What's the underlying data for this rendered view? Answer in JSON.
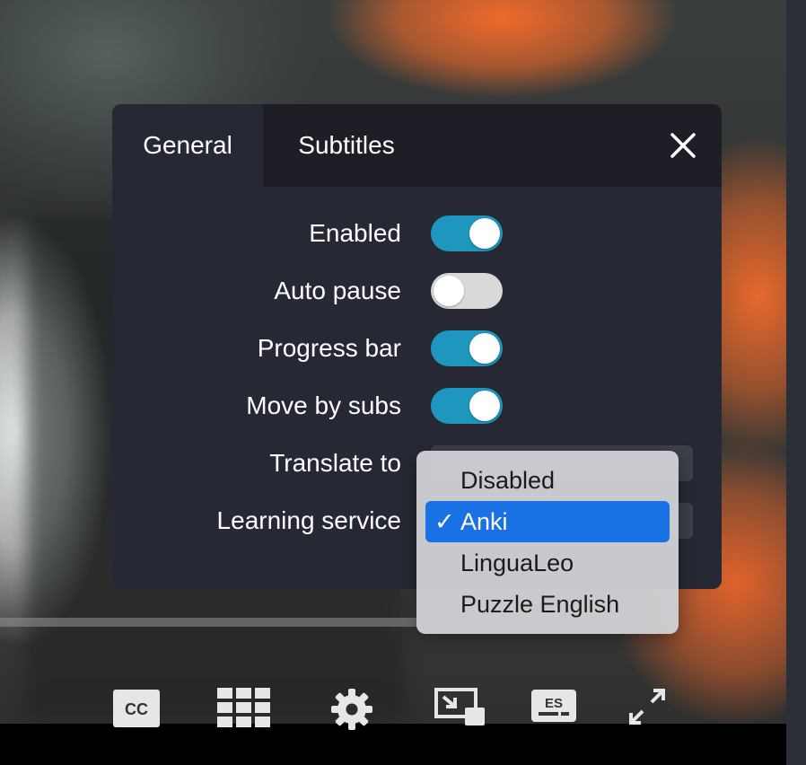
{
  "tabs": [
    {
      "label": "General",
      "active": true
    },
    {
      "label": "Subtitles",
      "active": false
    }
  ],
  "settings": {
    "enabled": {
      "label": "Enabled",
      "on": true
    },
    "auto_pause": {
      "label": "Auto pause",
      "on": false
    },
    "progress_bar": {
      "label": "Progress bar",
      "on": true
    },
    "move_by_subs": {
      "label": "Move by subs",
      "on": true
    },
    "translate_to": {
      "label": "Translate to"
    },
    "learning_service": {
      "label": "Learning service",
      "value": "Anki"
    }
  },
  "dropdown": {
    "check_mark": "✓",
    "options": [
      "Disabled",
      "Anki",
      "LinguaLeo",
      "Puzzle English"
    ],
    "selected_index": 1
  },
  "controls": {
    "cc_label": "CC",
    "es_label": "ES",
    "icons": [
      "closed-captions-icon",
      "grid-icon",
      "gear-icon",
      "picture-in-picture-icon",
      "subtitle-language-icon",
      "fullscreen-icon"
    ]
  },
  "colors": {
    "toggle_on": "#1e96be",
    "toggle_off": "#d9d9d9",
    "panel": "#262833",
    "selected_option": "#1a71e3"
  }
}
